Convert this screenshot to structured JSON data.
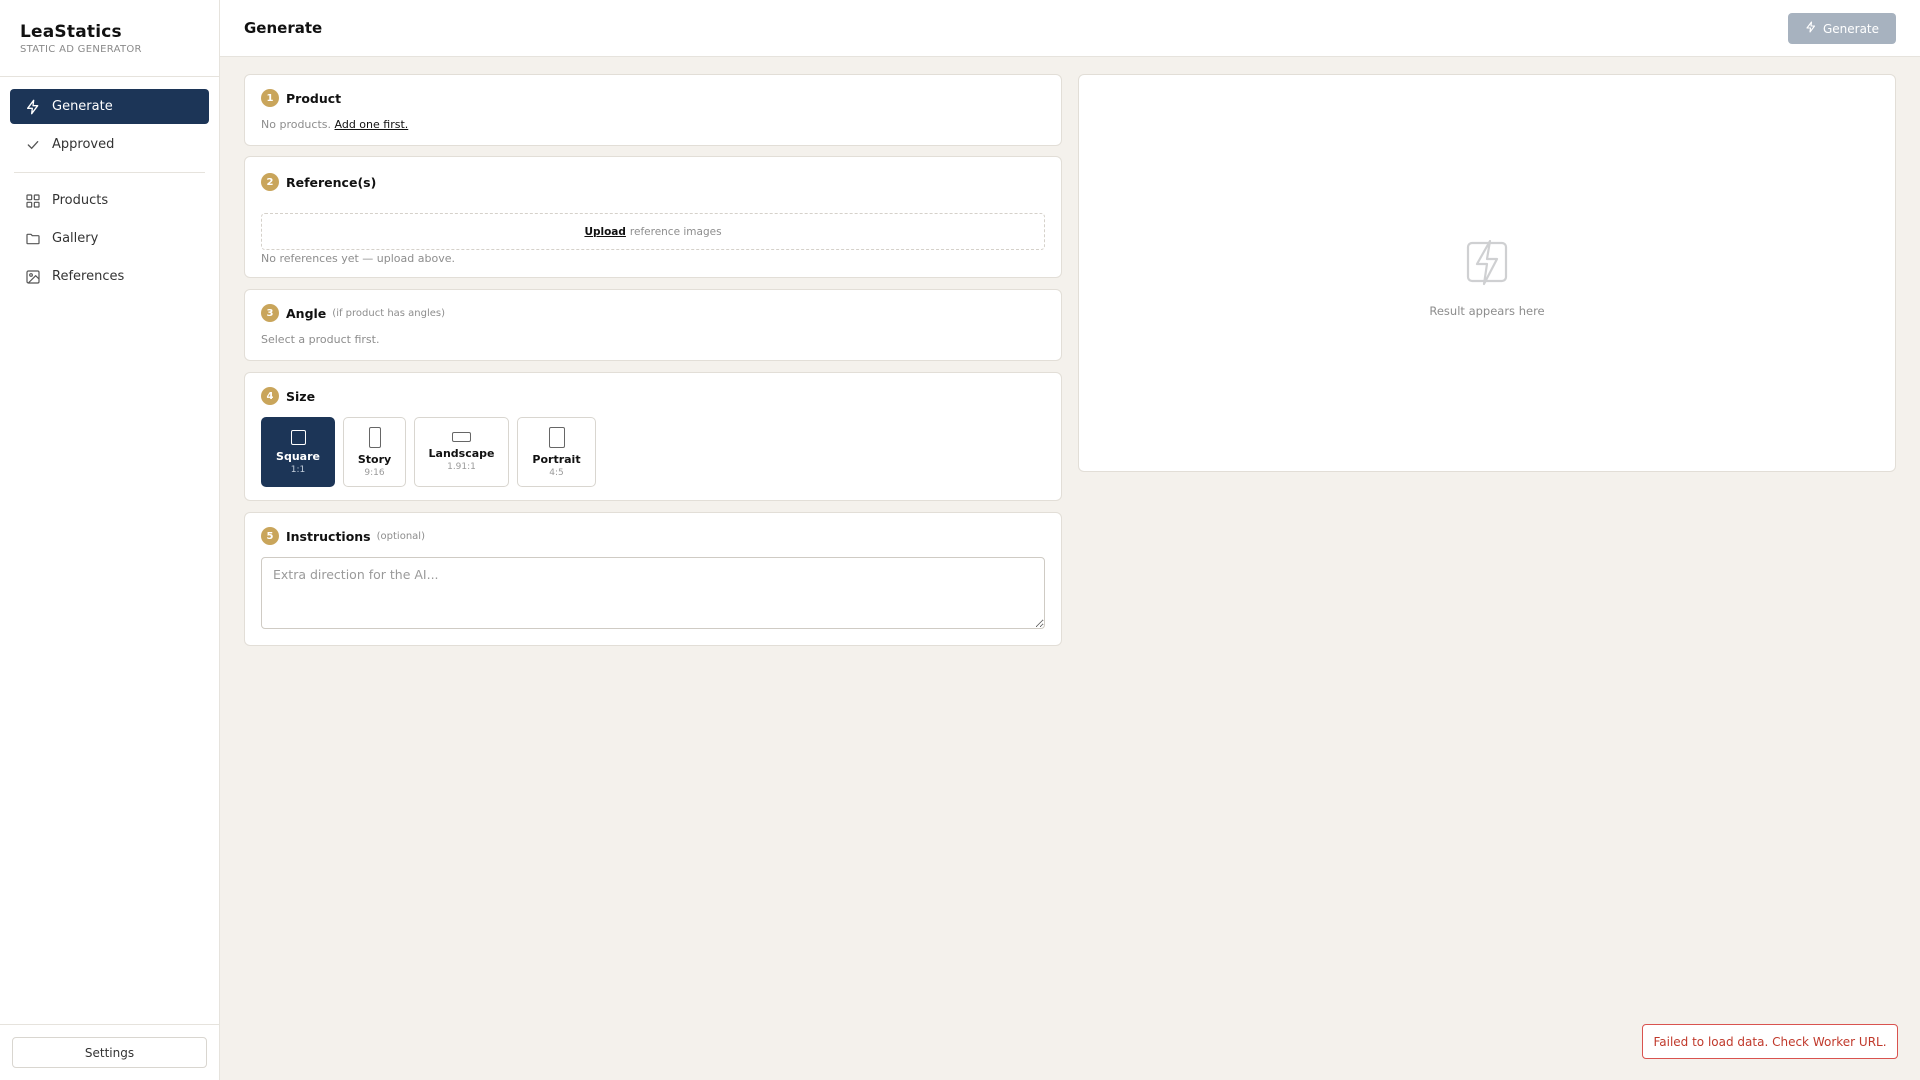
{
  "brand": {
    "title": "LeaStatics",
    "subtitle": "STATIC AD GENERATOR"
  },
  "sidebar": {
    "items": [
      {
        "label": "Generate",
        "icon": "lightning-icon",
        "active": true
      },
      {
        "label": "Approved",
        "icon": "check-icon",
        "active": false
      },
      {
        "label": "Products",
        "icon": "grid-icon",
        "active": false
      },
      {
        "label": "Gallery",
        "icon": "folder-icon",
        "active": false
      },
      {
        "label": "References",
        "icon": "image-icon",
        "active": false
      }
    ],
    "settings_label": "Settings"
  },
  "header": {
    "title": "Generate",
    "generate_label": "Generate"
  },
  "steps": {
    "product": {
      "num": "1",
      "title": "Product",
      "empty_text": "No products.",
      "link": "Add one first."
    },
    "references": {
      "num": "2",
      "title": "Reference(s)",
      "upload_link": "Upload",
      "upload_text": "reference images",
      "empty_text": "No references yet — upload above."
    },
    "angle": {
      "num": "3",
      "title": "Angle",
      "hint": "(if product has angles)",
      "empty_text": "Select a product first."
    },
    "size": {
      "num": "4",
      "title": "Size",
      "options": [
        {
          "label": "Square",
          "ratio": "1:1",
          "selected": true
        },
        {
          "label": "Story",
          "ratio": "9:16",
          "selected": false
        },
        {
          "label": "Landscape",
          "ratio": "1.91:1",
          "selected": false
        },
        {
          "label": "Portrait",
          "ratio": "4:5",
          "selected": false
        }
      ]
    },
    "instructions": {
      "num": "5",
      "title": "Instructions",
      "hint": "(optional)",
      "placeholder": "Extra direction for the AI...",
      "value": ""
    }
  },
  "result": {
    "placeholder": "Result appears here",
    "icon": "lightning-icon"
  },
  "toast": {
    "message": "Failed to load data. Check Worker URL."
  },
  "colors": {
    "accent": "#1c3557",
    "step_badge": "#c9a55b",
    "error": "#c0392b",
    "disabled_button": "#a7b2bf"
  }
}
